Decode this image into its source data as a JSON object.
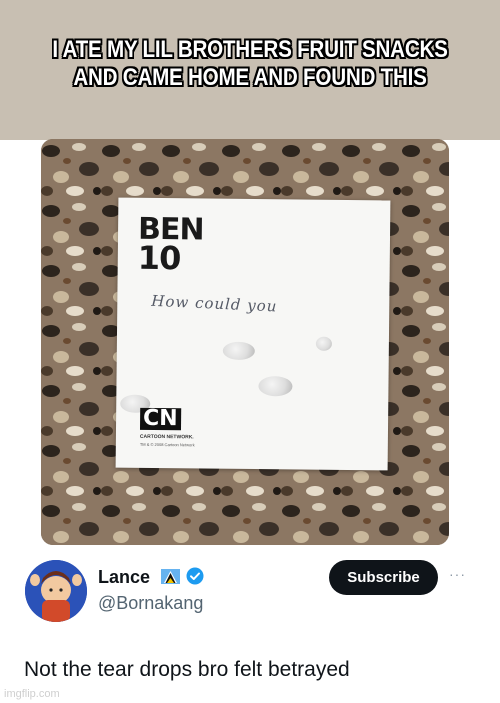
{
  "meme": {
    "caption": "I ATE MY LIL BROTHERS FRUIT SNACKS AND CAME HOME AND FOUND THIS"
  },
  "note": {
    "logo_text_top": "BEN",
    "logo_text_bottom": "10",
    "handwriting": "How could you",
    "footer_logo": "CN",
    "footer_brand": "CARTOON NETWORK.",
    "footer_small": "TM & © 2008 Cartoon Network"
  },
  "tweet": {
    "display_name": "Lance",
    "handle": "@Bornakang",
    "subscribe_label": "Subscribe",
    "more_label": "···",
    "text": "Not the tear drops bro felt betrayed"
  },
  "watermark": "imgflip.com",
  "colors": {
    "banner": "#c8bfb2",
    "subscribe_bg": "#0f1419",
    "verified": "#1d9bf0"
  }
}
